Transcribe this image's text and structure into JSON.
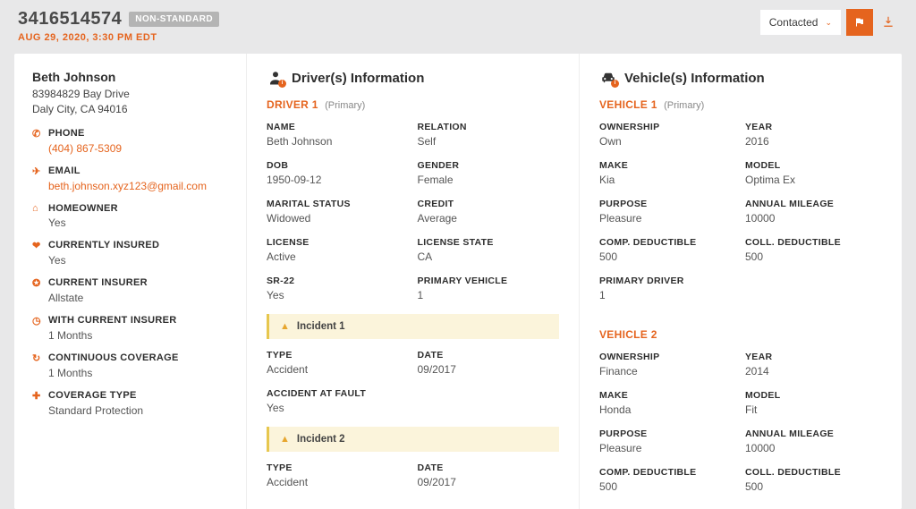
{
  "header": {
    "lead_id": "3416514574",
    "badge": "NON-STANDARD",
    "date": "AUG 29, 2020, 3:30 PM EDT",
    "status": "Contacted"
  },
  "customer": {
    "name": "Beth Johnson",
    "address1": "83984829 Bay Drive",
    "address2": "Daly City, CA 94016",
    "phone_label": "PHONE",
    "phone": "(404) 867-5309",
    "email_label": "EMAIL",
    "email": "beth.johnson.xyz123@gmail.com",
    "homeowner_label": "HOMEOWNER",
    "homeowner": "Yes",
    "currently_insured_label": "CURRENTLY INSURED",
    "currently_insured": "Yes",
    "current_insurer_label": "CURRENT INSURER",
    "current_insurer": "Allstate",
    "with_current_insurer_label": "WITH CURRENT INSURER",
    "with_current_insurer": "1 Months",
    "continuous_coverage_label": "CONTINUOUS COVERAGE",
    "continuous_coverage": "1 Months",
    "coverage_type_label": "COVERAGE TYPE",
    "coverage_type": "Standard Protection"
  },
  "drivers": {
    "section_title": "Driver(s) Information",
    "driver1": {
      "head": "DRIVER 1",
      "sub": "(Primary)",
      "name_label": "NAME",
      "name": "Beth Johnson",
      "relation_label": "RELATION",
      "relation": "Self",
      "dob_label": "DOB",
      "dob": "1950-09-12",
      "gender_label": "GENDER",
      "gender": "Female",
      "marital_label": "MARITAL STATUS",
      "marital": "Widowed",
      "credit_label": "CREDIT",
      "credit": "Average",
      "license_label": "LICENSE",
      "license": "Active",
      "license_state_label": "LICENSE STATE",
      "license_state": "CA",
      "sr22_label": "SR-22",
      "sr22": "Yes",
      "primary_vehicle_label": "PRIMARY VEHICLE",
      "primary_vehicle": "1",
      "incidents": {
        "i1": {
          "label": "Incident 1",
          "type_label": "TYPE",
          "type": "Accident",
          "date_label": "DATE",
          "date": "09/2017",
          "at_fault_label": "ACCIDENT AT FAULT",
          "at_fault": "Yes"
        },
        "i2": {
          "label": "Incident 2",
          "type_label": "TYPE",
          "type": "Accident",
          "date_label": "DATE",
          "date": "09/2017"
        }
      }
    }
  },
  "vehicles": {
    "section_title": "Vehicle(s) Information",
    "v1": {
      "head": "VEHICLE 1",
      "sub": "(Primary)",
      "ownership_label": "OWNERSHIP",
      "ownership": "Own",
      "year_label": "YEAR",
      "year": "2016",
      "make_label": "MAKE",
      "make": "Kia",
      "model_label": "MODEL",
      "model": "Optima Ex",
      "purpose_label": "PURPOSE",
      "purpose": "Pleasure",
      "annual_mileage_label": "ANNUAL MILEAGE",
      "annual_mileage": "10000",
      "comp_label": "COMP. DEDUCTIBLE",
      "comp": "500",
      "coll_label": "COLL. DEDUCTIBLE",
      "coll": "500",
      "primary_driver_label": "PRIMARY DRIVER",
      "primary_driver": "1"
    },
    "v2": {
      "head": "VEHICLE 2",
      "ownership_label": "OWNERSHIP",
      "ownership": "Finance",
      "year_label": "YEAR",
      "year": "2014",
      "make_label": "MAKE",
      "make": "Honda",
      "model_label": "MODEL",
      "model": "Fit",
      "purpose_label": "PURPOSE",
      "purpose": "Pleasure",
      "annual_mileage_label": "ANNUAL MILEAGE",
      "annual_mileage": "10000",
      "comp_label": "COMP. DEDUCTIBLE",
      "comp": "500",
      "coll_label": "COLL. DEDUCTIBLE",
      "coll": "500"
    }
  }
}
